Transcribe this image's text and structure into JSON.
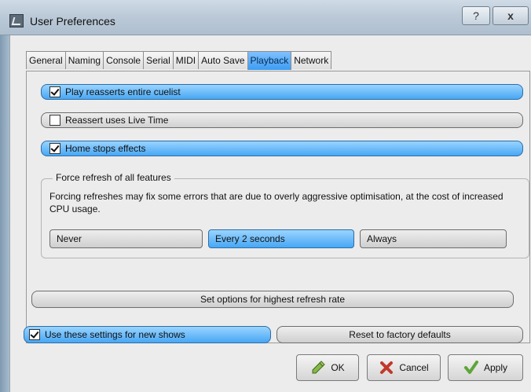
{
  "window": {
    "title": "User Preferences",
    "help_label": "?",
    "close_label": "x"
  },
  "tabs": [
    {
      "label": "General",
      "active": false
    },
    {
      "label": "Naming",
      "active": false
    },
    {
      "label": "Console",
      "active": false
    },
    {
      "label": "Serial",
      "active": false
    },
    {
      "label": "MIDI",
      "active": false
    },
    {
      "label": "Auto Save",
      "active": false
    },
    {
      "label": "Playback",
      "active": true
    },
    {
      "label": "Network",
      "active": false
    }
  ],
  "options": [
    {
      "label": "Play reasserts entire cuelist",
      "checked": true
    },
    {
      "label": "Reassert uses Live Time",
      "checked": false
    },
    {
      "label": "Home stops effects",
      "checked": true
    }
  ],
  "refresh_group": {
    "legend": "Force refresh of all features",
    "description": "Forcing refreshes may fix some errors that are due to overly aggressive optimisation, at the cost of increased CPU usage.",
    "choices": [
      "Never",
      "Every 2 seconds",
      "Always"
    ],
    "selected": "Every 2 seconds"
  },
  "highest_refresh_label": "Set options for highest refresh rate",
  "use_settings": {
    "label": "Use these settings for new shows",
    "checked": true
  },
  "reset_label": "Reset to factory defaults",
  "buttons": {
    "ok": "OK",
    "cancel": "Cancel",
    "apply": "Apply"
  },
  "colors": {
    "accent": "#48a7f4",
    "accent_light": "#9ad4ff"
  },
  "icons": {
    "ok": "pencil-check-icon",
    "cancel": "x-icon",
    "apply": "checkmark-icon"
  }
}
